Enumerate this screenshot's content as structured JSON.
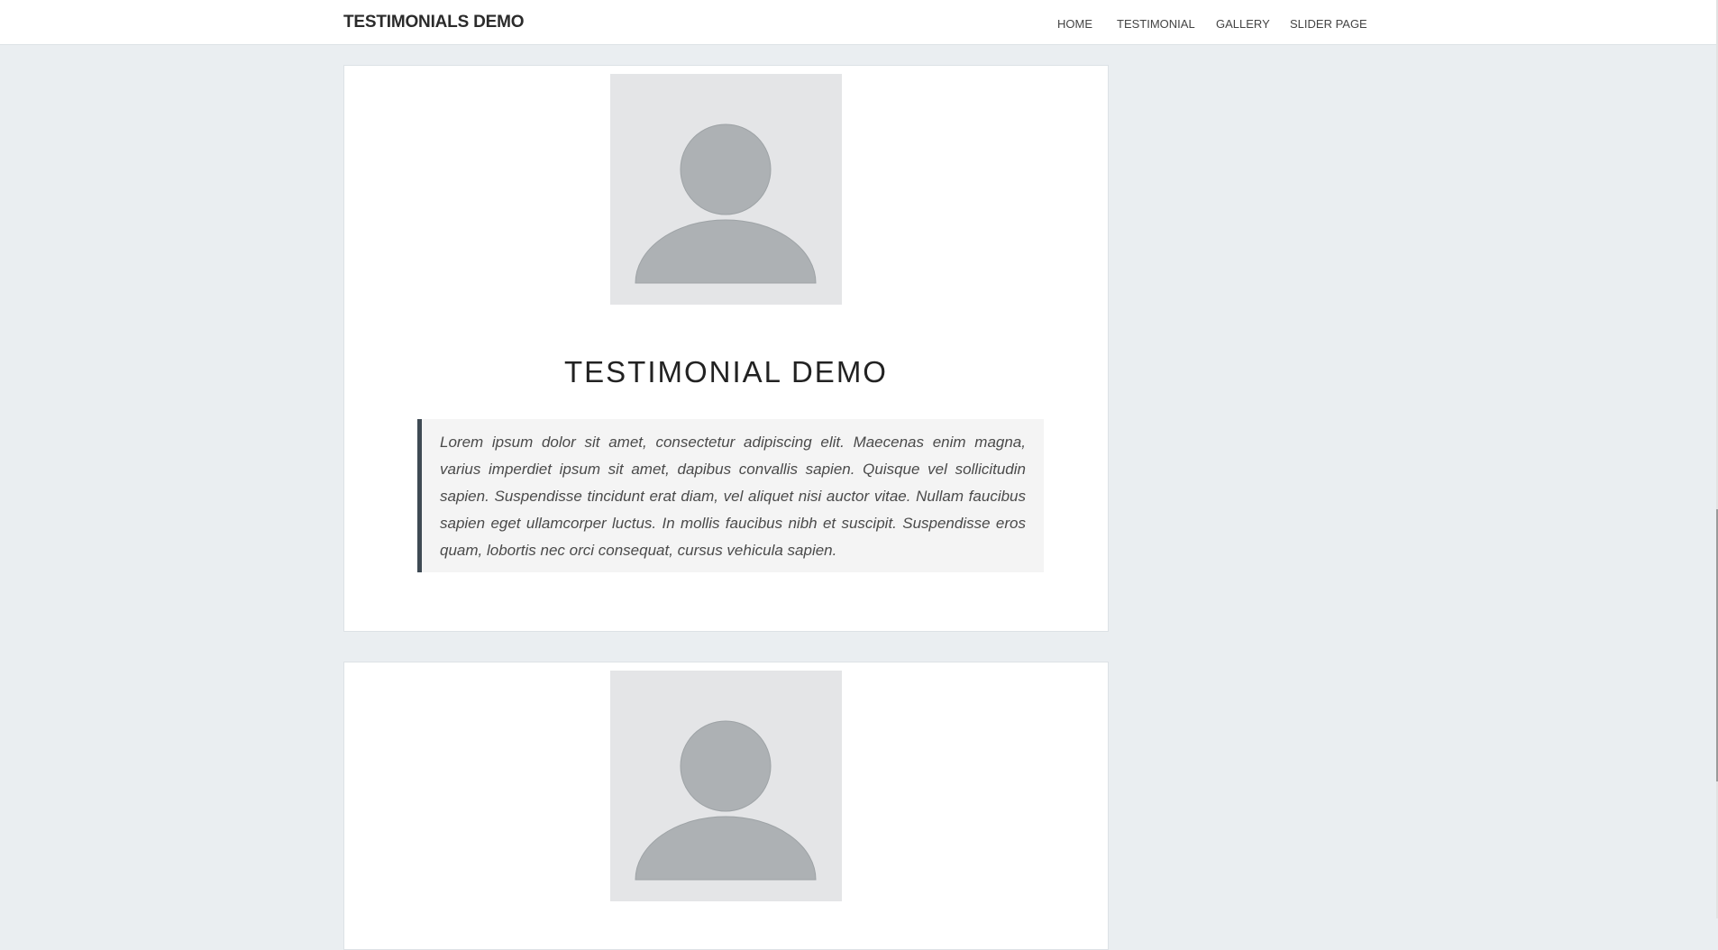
{
  "header": {
    "brand": "TESTIMONIALS DEMO",
    "nav": [
      {
        "label": "HOME"
      },
      {
        "label": "TESTIMONIAL"
      },
      {
        "label": "GALLERY"
      },
      {
        "label": "SLIDER PAGE"
      }
    ]
  },
  "testimonials": [
    {
      "avatar_icon": "user-placeholder-icon",
      "title": "TESTIMONIAL DEMO",
      "quote": "Lorem ipsum dolor sit amet, consectetur adipiscing elit. Maecenas enim magna, varius imperdiet ipsum sit amet, dapibus convallis sapien. Quisque vel sollicitudin sapien. Suspendisse tincidunt erat diam, vel aliquet nisi auctor vitae. Nullam faucibus sapien eget ullamcorper luctus. In mollis faucibus nibh et suscipit. Suspendisse eros quam, lobortis nec orci consequat, cursus vehicula sapien."
    },
    {
      "avatar_icon": "user-placeholder-icon"
    }
  ],
  "colors": {
    "page_background": "#eaeef1",
    "card_background": "#ffffff",
    "quote_background": "#f4f4f4",
    "quote_border": "#3f4a54",
    "avatar_background": "#e4e5e7",
    "avatar_figure": "#adb1b4"
  }
}
